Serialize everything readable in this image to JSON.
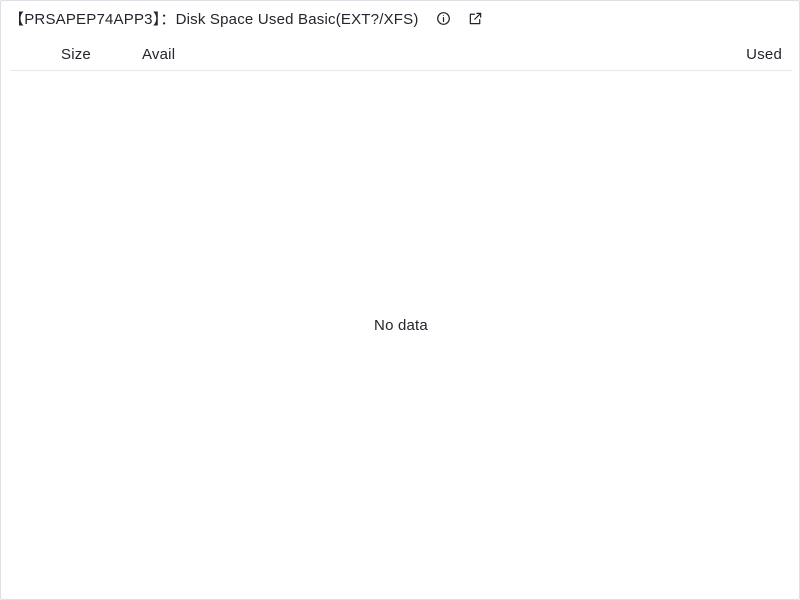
{
  "panel": {
    "title": "【PRSAPEP74APP3】：Disk Space Used Basic(EXT?/XFS)",
    "icons": {
      "info": "info-circle-icon",
      "open": "external-link-icon"
    }
  },
  "table": {
    "columns": [
      "Size",
      "Avail",
      "Used"
    ],
    "rows": [],
    "empty_text": "No data"
  }
}
